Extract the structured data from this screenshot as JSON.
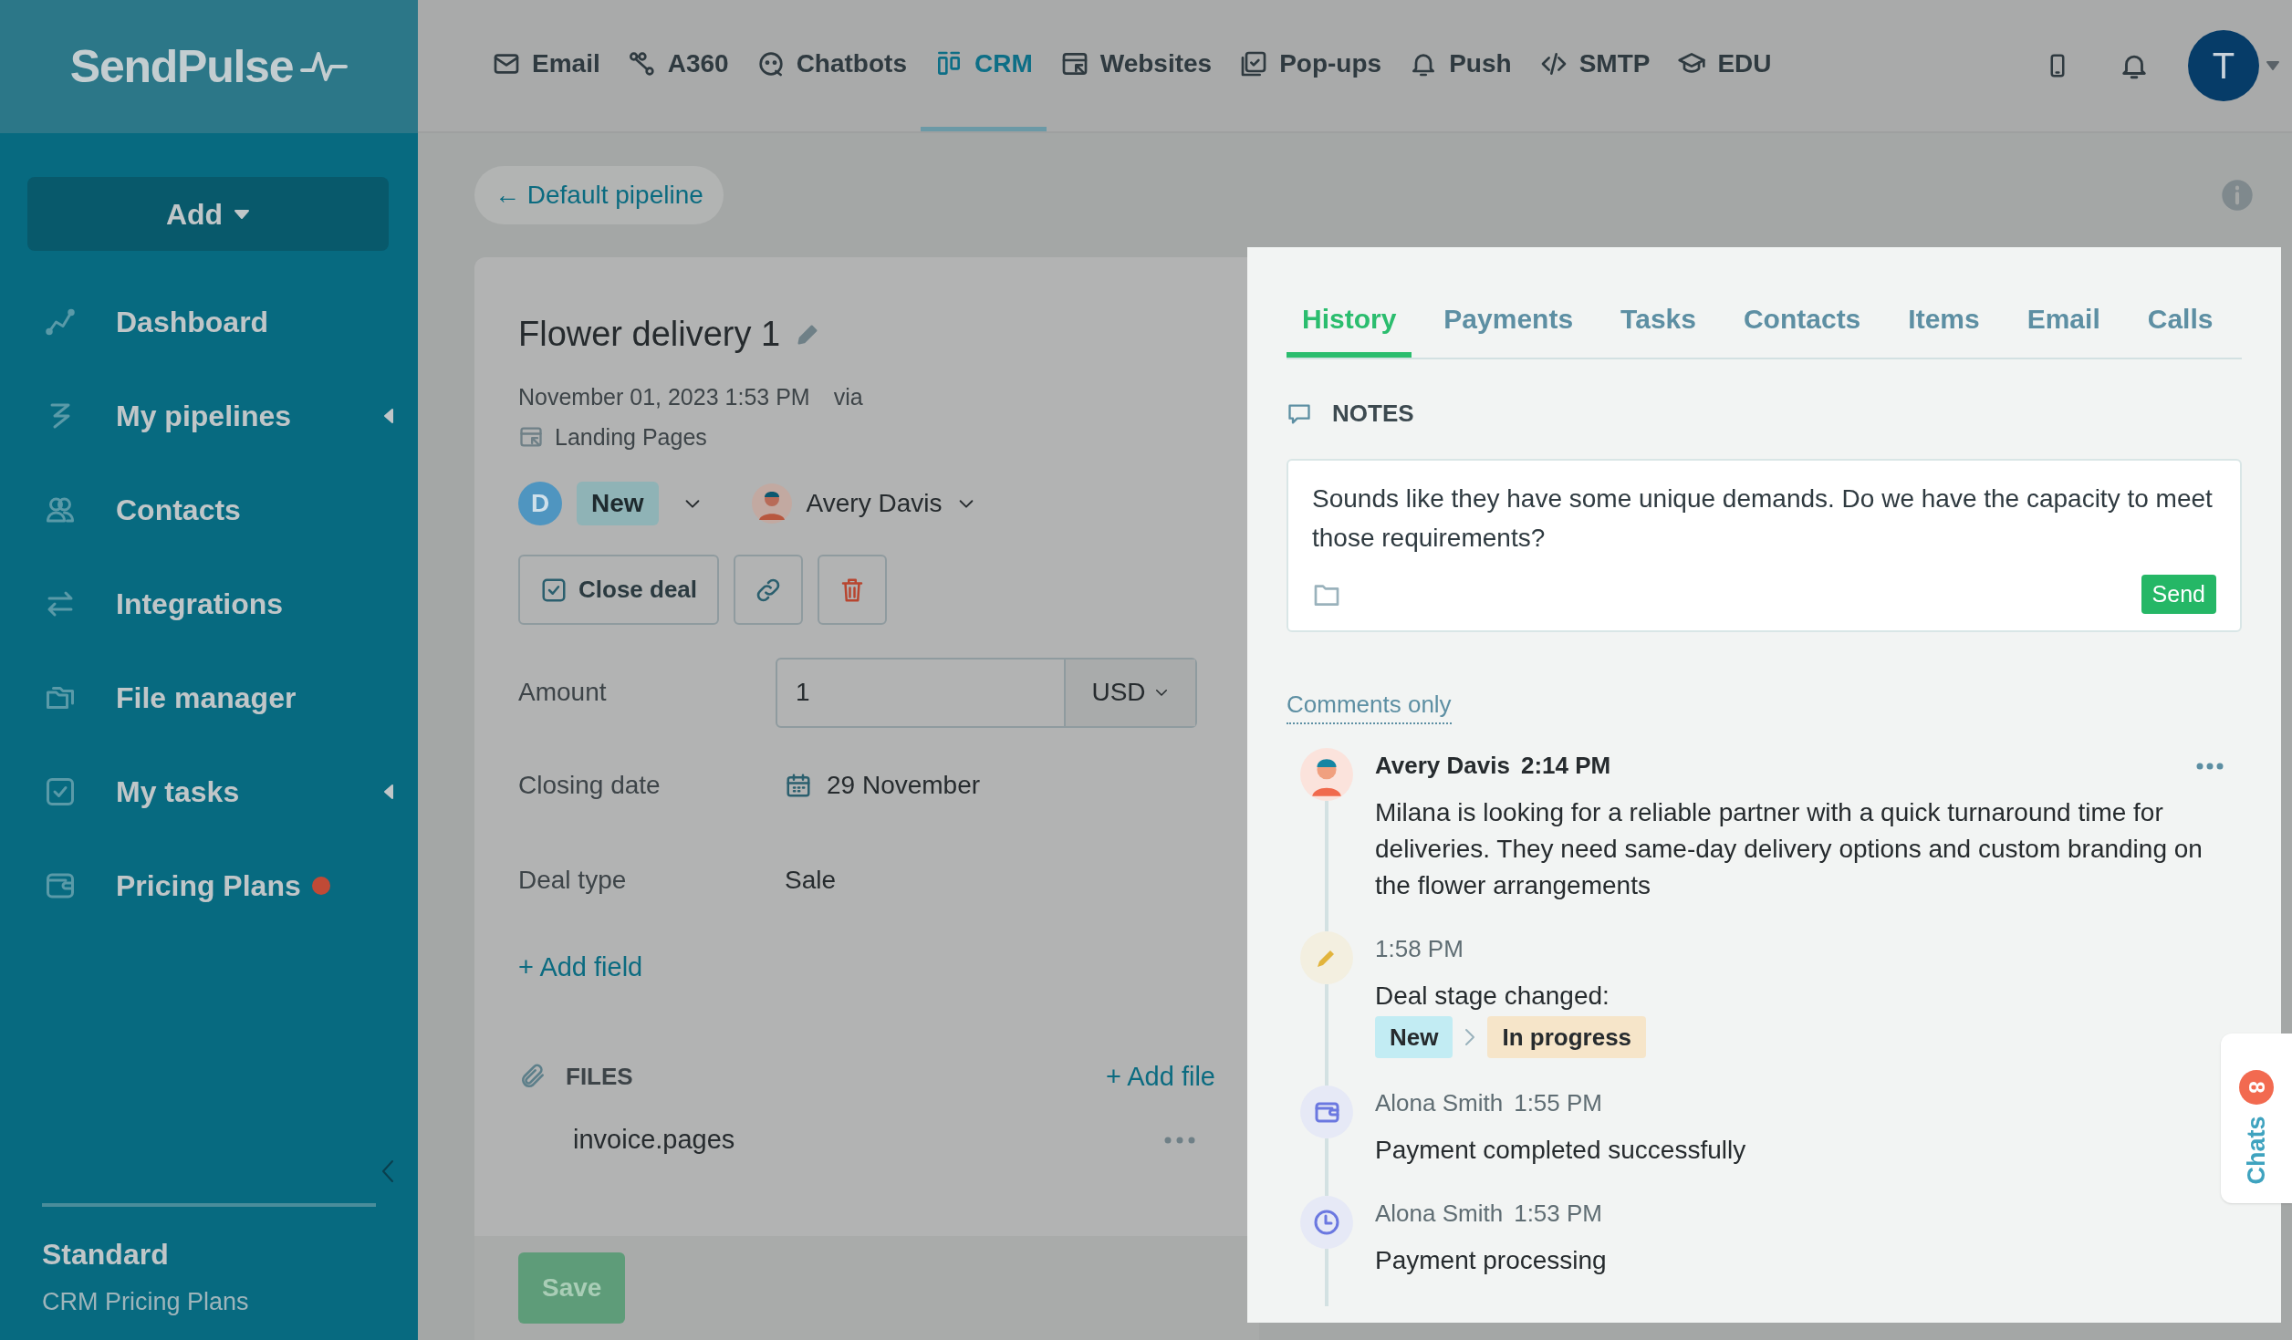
{
  "sidebar": {
    "logo": "SendPulse",
    "add_button": "Add",
    "items": [
      {
        "label": "Dashboard",
        "has_submenu": false,
        "dot": false
      },
      {
        "label": "My pipelines",
        "has_submenu": true,
        "dot": false
      },
      {
        "label": "Contacts",
        "has_submenu": false,
        "dot": false
      },
      {
        "label": "Integrations",
        "has_submenu": false,
        "dot": false
      },
      {
        "label": "File manager",
        "has_submenu": false,
        "dot": false
      },
      {
        "label": "My tasks",
        "has_submenu": true,
        "dot": false
      },
      {
        "label": "Pricing Plans",
        "has_submenu": false,
        "dot": true
      }
    ],
    "plan": {
      "name": "Standard",
      "subtitle": "CRM Pricing Plans"
    }
  },
  "top_nav": {
    "items": [
      {
        "label": "Email",
        "selected": false
      },
      {
        "label": "A360",
        "selected": false
      },
      {
        "label": "Chatbots",
        "selected": false
      },
      {
        "label": "CRM",
        "selected": true
      },
      {
        "label": "Websites",
        "selected": false
      },
      {
        "label": "Pop-ups",
        "selected": false
      },
      {
        "label": "Push",
        "selected": false
      },
      {
        "label": "SMTP",
        "selected": false
      },
      {
        "label": "EDU",
        "selected": false
      }
    ],
    "avatar_initial": "T"
  },
  "breadcrumb": "← Default pipeline",
  "deal": {
    "title": "Flower delivery 1",
    "created": "November 01, 2023 1:53 PM",
    "via": "via",
    "source": "Landing Pages",
    "stage_initial": "D",
    "stage": "New",
    "owner": "Avery Davis",
    "close_button": "Close deal",
    "fields": [
      {
        "kind": "amount",
        "label": "Amount",
        "value": "1",
        "currency": "USD"
      },
      {
        "kind": "date",
        "label": "Closing date",
        "value": "29 November"
      },
      {
        "kind": "text",
        "label": "Deal type",
        "value": "Sale"
      }
    ],
    "add_field": "+ Add field",
    "files": {
      "title": "FILES",
      "add": "+ Add file",
      "items": [
        "invoice.pages"
      ]
    },
    "save_button": "Save"
  },
  "panel": {
    "tabs": [
      {
        "label": "History",
        "selected": true
      },
      {
        "label": "Payments",
        "selected": false
      },
      {
        "label": "Tasks",
        "selected": false
      },
      {
        "label": "Contacts",
        "selected": false
      },
      {
        "label": "Items",
        "selected": false
      },
      {
        "label": "Email",
        "selected": false
      },
      {
        "label": "Calls",
        "selected": false
      }
    ],
    "notes": {
      "title": "NOTES",
      "text": "Sounds like they have some unique demands. Do we have the capacity to meet those requirements?",
      "send": "Send"
    },
    "filter": "Comments only",
    "history": [
      {
        "kind": "comment",
        "author": "Avery Davis",
        "time": "2:14 PM",
        "text": "Milana is looking for a reliable partner with a quick turnaround time for deliveries. They need same-day delivery options and custom branding on the flower arrangements"
      },
      {
        "kind": "stage_change",
        "time": "1:58 PM",
        "text": "Deal stage changed:",
        "from": "New",
        "to": "In progress"
      },
      {
        "kind": "payment",
        "author": "Alona Smith",
        "time": "1:55 PM",
        "text": "Payment completed successfully"
      },
      {
        "kind": "pending",
        "author": "Alona Smith",
        "time": "1:53 PM",
        "text": "Payment processing"
      }
    ]
  },
  "chats": {
    "label": "Chats",
    "count": "8"
  }
}
